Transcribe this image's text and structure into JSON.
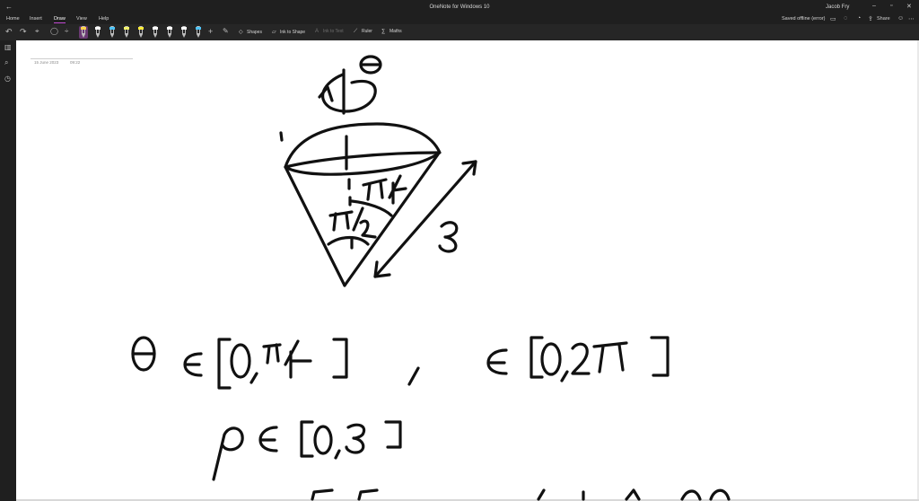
{
  "window": {
    "title": "OneNote for Windows 10",
    "user": "Jacob Fry"
  },
  "menu": {
    "tabs": [
      "Home",
      "Insert",
      "Draw",
      "View",
      "Help"
    ],
    "active_tab": "Draw",
    "status": "Saved offline (error)",
    "share_label": "Share"
  },
  "toolbar": {
    "shapes_label": "Shapes",
    "ink_to_shape_label": "Ink to Shape",
    "ink_to_text_label": "Ink to Text",
    "ruler_label": "Ruler",
    "maths_label": "Maths",
    "pen_colors": [
      "#ffd24a",
      "#ffffff",
      "#4fc3f7",
      "#f2f26b",
      "#ffeb3b",
      "#ffffff",
      "#ffffff",
      "#ffffff",
      "#ffffff",
      "#4fc3f7",
      "#ffffff"
    ]
  },
  "page": {
    "date": "15 June 2023",
    "time": "09:22"
  }
}
